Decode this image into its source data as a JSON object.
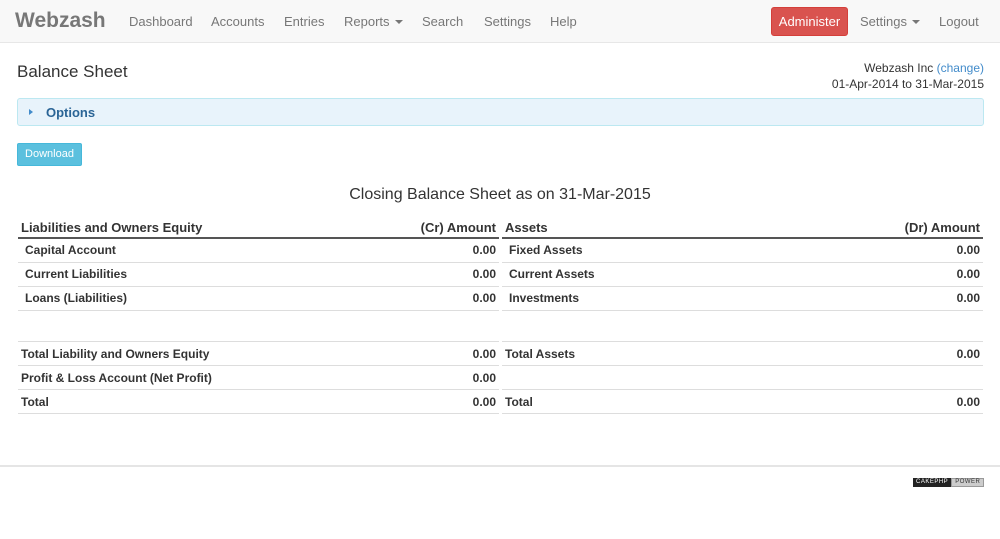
{
  "navbar": {
    "brand": "Webzash",
    "items": [
      "Dashboard",
      "Accounts",
      "Entries",
      "Reports",
      "Search",
      "Settings",
      "Help"
    ],
    "admin": "Administer",
    "settings": "Settings",
    "logout": "Logout"
  },
  "header": {
    "title": "Balance Sheet",
    "company": "Webzash Inc",
    "change": "(change)",
    "period": "01-Apr-2014 to 31-Mar-2015"
  },
  "options": {
    "label": "Options"
  },
  "download": "Download",
  "sheet_title": "Closing Balance Sheet as on 31-Mar-2015",
  "liabilities": {
    "header": "Liabilities and Owners Equity",
    "amount_header": "(Cr) Amount",
    "rows": [
      {
        "name": "Capital Account",
        "amount": "0.00"
      },
      {
        "name": "Current Liabilities",
        "amount": "0.00"
      },
      {
        "name": "Loans (Liabilities)",
        "amount": "0.00"
      }
    ],
    "totals": [
      {
        "name": "Total Liability and Owners Equity",
        "amount": "0.00"
      },
      {
        "name": "Profit & Loss Account (Net Profit)",
        "amount": "0.00"
      },
      {
        "name": "Total",
        "amount": "0.00"
      }
    ]
  },
  "assets": {
    "header": "Assets",
    "amount_header": "(Dr) Amount",
    "rows": [
      {
        "name": "Fixed Assets",
        "amount": "0.00"
      },
      {
        "name": "Current Assets",
        "amount": "0.00"
      },
      {
        "name": "Investments",
        "amount": "0.00"
      }
    ],
    "totals": [
      {
        "name": "Total Assets",
        "amount": "0.00"
      },
      {
        "name": "",
        "amount": ""
      },
      {
        "name": "Total",
        "amount": "0.00"
      }
    ]
  },
  "footer": {
    "powered_a": "CAKEPHP",
    "powered_b": "POWER"
  }
}
